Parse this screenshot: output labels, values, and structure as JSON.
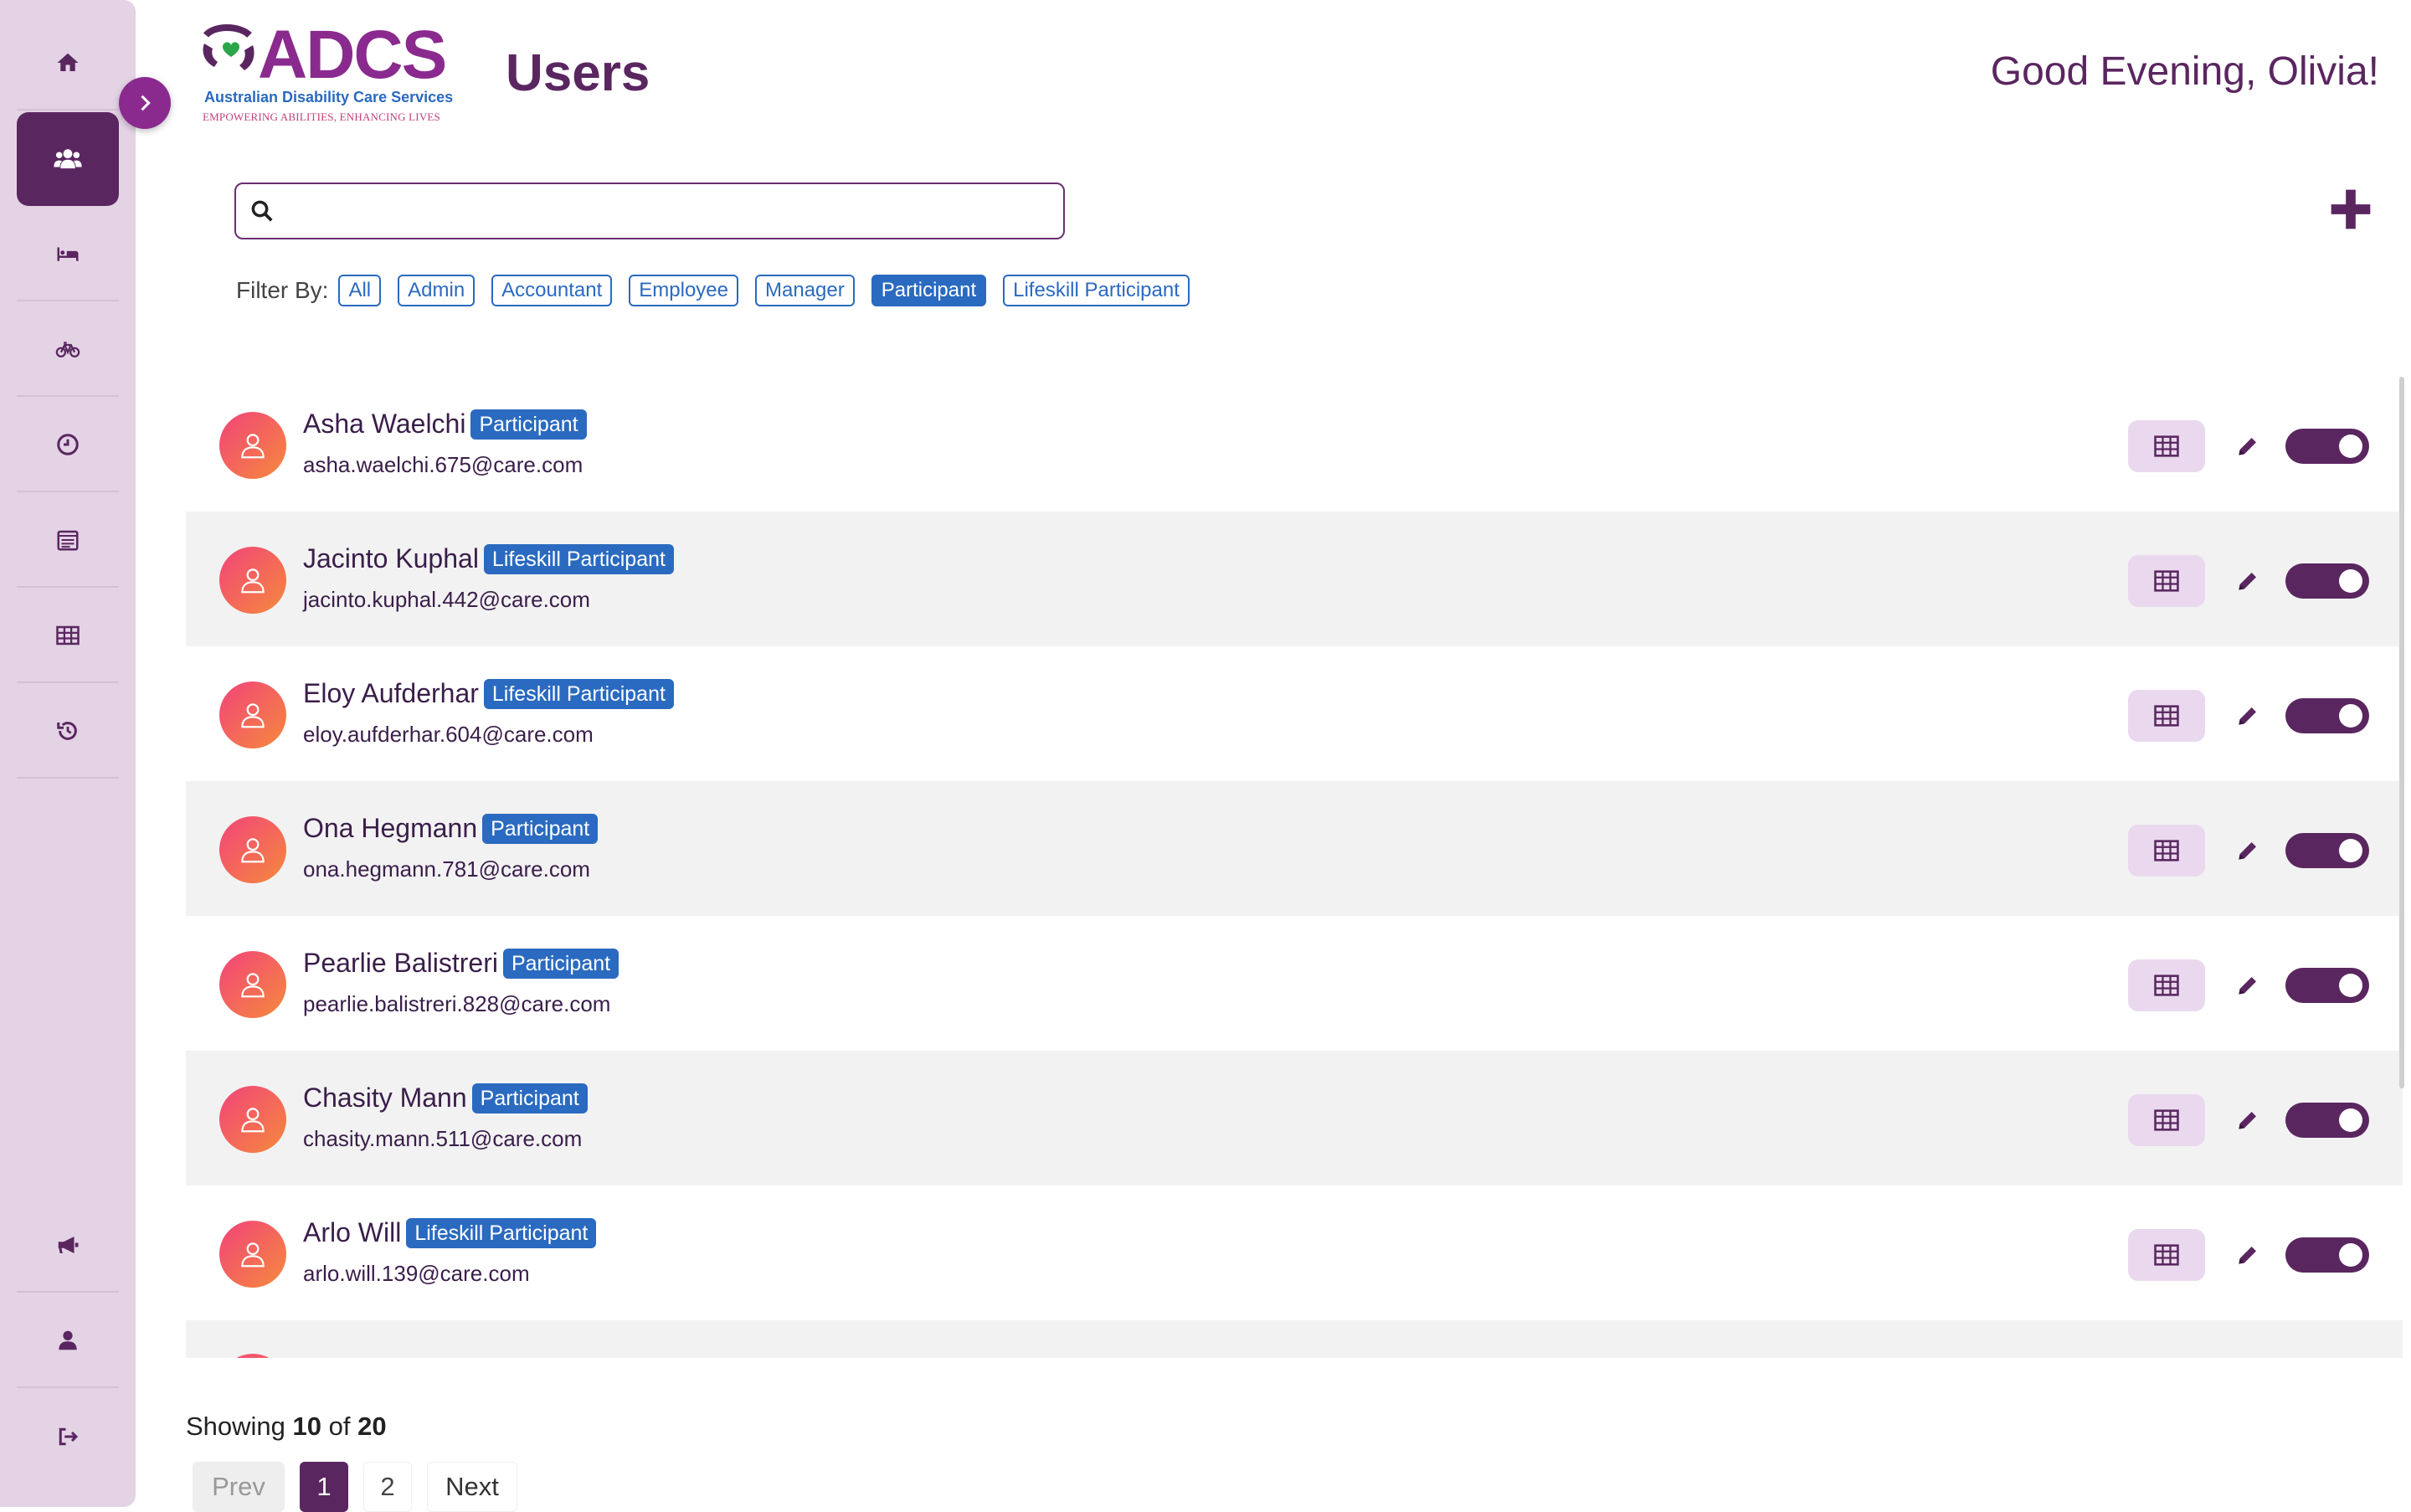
{
  "header": {
    "title": "Users",
    "greeting": "Good Evening, Olivia!",
    "logo": {
      "mark": "ADCS",
      "name": "Australian Disability Care Services",
      "tagline": "EMPOWERING ABILITIES, ENHANCING LIVES"
    }
  },
  "sidebar": {
    "items": [
      {
        "icon": "home-icon"
      },
      {
        "icon": "users-icon",
        "active": true
      },
      {
        "icon": "bed-icon"
      },
      {
        "icon": "bicycle-icon"
      },
      {
        "icon": "clock-icon"
      },
      {
        "icon": "calendar-list-icon"
      },
      {
        "icon": "table-icon"
      },
      {
        "icon": "history-icon"
      }
    ],
    "bottom_items": [
      {
        "icon": "megaphone-icon"
      },
      {
        "icon": "user-icon"
      },
      {
        "icon": "sign-out-icon"
      }
    ]
  },
  "search": {
    "value": "",
    "placeholder": ""
  },
  "filters": {
    "label": "Filter By:",
    "options": [
      "All",
      "Admin",
      "Accountant",
      "Employee",
      "Manager",
      "Participant",
      "Lifeskill Participant"
    ],
    "selected": "Participant"
  },
  "users": [
    {
      "name": "Asha Waelchi",
      "role": "Participant",
      "email": "asha.waelchi.675@care.com",
      "active": true
    },
    {
      "name": "Jacinto Kuphal",
      "role": "Lifeskill Participant",
      "email": "jacinto.kuphal.442@care.com",
      "active": true
    },
    {
      "name": "Eloy Aufderhar",
      "role": "Lifeskill Participant",
      "email": "eloy.aufderhar.604@care.com",
      "active": true
    },
    {
      "name": "Ona Hegmann",
      "role": "Participant",
      "email": "ona.hegmann.781@care.com",
      "active": true
    },
    {
      "name": "Pearlie Balistreri",
      "role": "Participant",
      "email": "pearlie.balistreri.828@care.com",
      "active": true
    },
    {
      "name": "Chasity Mann",
      "role": "Participant",
      "email": "chasity.mann.511@care.com",
      "active": true
    },
    {
      "name": "Arlo Will",
      "role": "Lifeskill Participant",
      "email": "arlo.will.139@care.com",
      "active": true
    }
  ],
  "footer": {
    "showing_prefix": "Showing",
    "showing_count": "10",
    "showing_of": "of",
    "showing_total": "20",
    "prev_label": "Prev",
    "next_label": "Next",
    "pages": [
      "1",
      "2"
    ],
    "current_page": "1"
  },
  "colors": {
    "primary": "#5a2660",
    "accent_blue": "#2a6ac0",
    "sidebar_bg": "#e3d3e5"
  }
}
